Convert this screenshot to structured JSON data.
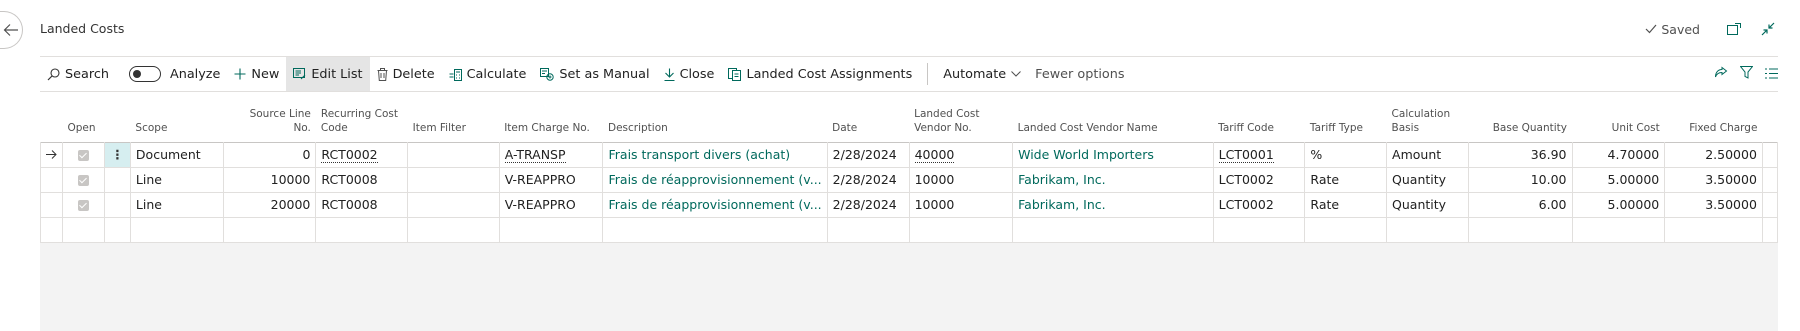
{
  "header": {
    "title": "Landed Costs",
    "saved_label": "Saved"
  },
  "actions": {
    "search": "Search",
    "analyze": "Analyze",
    "new": "New",
    "edit_list": "Edit List",
    "delete": "Delete",
    "calculate": "Calculate",
    "set_as_manual": "Set as Manual",
    "close": "Close",
    "landed_cost_assignments": "Landed Cost Assignments",
    "automate": "Automate",
    "fewer_options": "Fewer options"
  },
  "columns": {
    "open": "Open",
    "scope": "Scope",
    "source_line_no": "Source Line\nNo.",
    "recurring_cost_code": "Recurring Cost\nCode",
    "item_filter": "Item Filter",
    "item_charge_no": "Item Charge No.",
    "description": "Description",
    "date": "Date",
    "vendor_no": "Landed Cost\nVendor No.",
    "vendor_name": "Landed Cost Vendor Name",
    "tariff_code": "Tariff Code",
    "tariff_type": "Tariff Type",
    "calculation_basis": "Calculation\nBasis",
    "base_quantity": "Base Quantity",
    "unit_cost": "Unit Cost",
    "fixed_charge": "Fixed Charge"
  },
  "rows": [
    {
      "scope": "Document",
      "source_line_no": "0",
      "recurring_cost_code": "RCT0002",
      "item_filter": "",
      "item_charge_no": "A-TRANSP",
      "description": "Frais transport divers (achat)",
      "date": "2/28/2024",
      "vendor_no": "40000",
      "vendor_name": "Wide World Importers",
      "tariff_code": "LCT0001",
      "tariff_type": "%",
      "calculation_basis": "Amount",
      "base_quantity": "36.90",
      "unit_cost": "4.70000",
      "fixed_charge": "2.50000"
    },
    {
      "scope": "Line",
      "source_line_no": "10000",
      "recurring_cost_code": "RCT0008",
      "item_filter": "",
      "item_charge_no": "V-REAPPRO",
      "description": "Frais de réapprovisionnement (v...",
      "date": "2/28/2024",
      "vendor_no": "10000",
      "vendor_name": "Fabrikam, Inc.",
      "tariff_code": "LCT0002",
      "tariff_type": "Rate",
      "calculation_basis": "Quantity",
      "base_quantity": "10.00",
      "unit_cost": "5.00000",
      "fixed_charge": "3.50000"
    },
    {
      "scope": "Line",
      "source_line_no": "20000",
      "recurring_cost_code": "RCT0008",
      "item_filter": "",
      "item_charge_no": "V-REAPPRO",
      "description": "Frais de réapprovisionnement (v...",
      "date": "2/28/2024",
      "vendor_no": "10000",
      "vendor_name": "Fabrikam, Inc.",
      "tariff_code": "LCT0002",
      "tariff_type": "Rate",
      "calculation_basis": "Quantity",
      "base_quantity": "6.00",
      "unit_cost": "5.00000",
      "fixed_charge": "3.50000"
    }
  ],
  "colors": {
    "accent": "#00695c",
    "selected_cell": "#d6eef0",
    "grid_bg": "#f3f3f3"
  }
}
